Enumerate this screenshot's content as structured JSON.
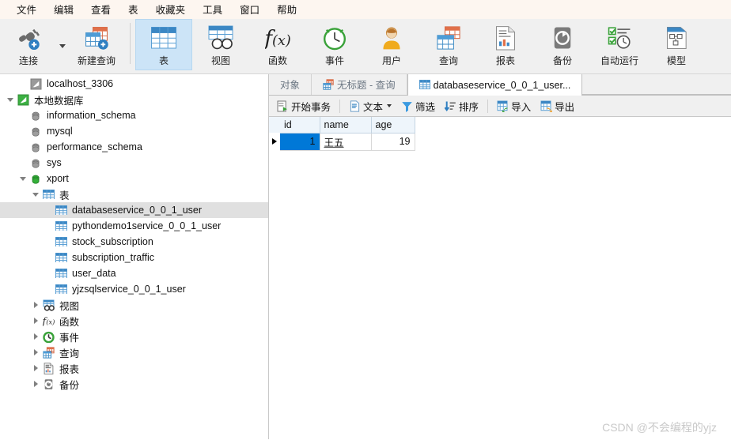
{
  "menubar": {
    "items": [
      {
        "label": "文件",
        "name": "menu-file"
      },
      {
        "label": "编辑",
        "name": "menu-edit"
      },
      {
        "label": "查看",
        "name": "menu-view"
      },
      {
        "label": "表",
        "name": "menu-table"
      },
      {
        "label": "收藏夹",
        "name": "menu-favorites"
      },
      {
        "label": "工具",
        "name": "menu-tools"
      },
      {
        "label": "窗口",
        "name": "menu-window"
      },
      {
        "label": "帮助",
        "name": "menu-help"
      }
    ]
  },
  "toolbar": {
    "buttons": [
      {
        "label": "连接",
        "icon": "connection-plug-icon",
        "selected": false
      },
      {
        "label": "新建查询",
        "icon": "new-query-icon",
        "selected": false
      },
      {
        "label": "表",
        "icon": "table-icon",
        "selected": true
      },
      {
        "label": "视图",
        "icon": "view-icon",
        "selected": false
      },
      {
        "label": "函数",
        "icon": "function-icon",
        "selected": false
      },
      {
        "label": "事件",
        "icon": "event-clock-icon",
        "selected": false
      },
      {
        "label": "用户",
        "icon": "user-icon",
        "selected": false
      },
      {
        "label": "查询",
        "icon": "query-icon",
        "selected": false
      },
      {
        "label": "报表",
        "icon": "report-icon",
        "selected": false
      },
      {
        "label": "备份",
        "icon": "backup-icon",
        "selected": false
      },
      {
        "label": "自动运行",
        "icon": "automation-icon",
        "selected": false
      },
      {
        "label": "模型",
        "icon": "model-icon",
        "selected": false
      }
    ]
  },
  "sidebar": {
    "tree": [
      {
        "label": "localhost_3306",
        "icon": "connection-gray-icon",
        "depth": 1,
        "twisty": "none",
        "selected": false
      },
      {
        "label": "本地数据库",
        "icon": "connection-green-icon",
        "depth": 0,
        "twisty": "expanded",
        "selected": false
      },
      {
        "label": "information_schema",
        "icon": "database-gray-icon",
        "depth": 1,
        "twisty": "none",
        "selected": false
      },
      {
        "label": "mysql",
        "icon": "database-gray-icon",
        "depth": 1,
        "twisty": "none",
        "selected": false
      },
      {
        "label": "performance_schema",
        "icon": "database-gray-icon",
        "depth": 1,
        "twisty": "none",
        "selected": false
      },
      {
        "label": "sys",
        "icon": "database-gray-icon",
        "depth": 1,
        "twisty": "none",
        "selected": false
      },
      {
        "label": "xport",
        "icon": "database-green-icon",
        "depth": 1,
        "twisty": "expanded",
        "selected": false
      },
      {
        "label": "表",
        "icon": "table-icon",
        "depth": 2,
        "twisty": "expanded",
        "selected": false
      },
      {
        "label": "databaseservice_0_0_1_user",
        "icon": "table-icon",
        "depth": 3,
        "twisty": "none",
        "selected": true
      },
      {
        "label": "pythondemo1service_0_0_1_user",
        "icon": "table-icon",
        "depth": 3,
        "twisty": "none",
        "selected": false
      },
      {
        "label": "stock_subscription",
        "icon": "table-icon",
        "depth": 3,
        "twisty": "none",
        "selected": false
      },
      {
        "label": "subscription_traffic",
        "icon": "table-icon",
        "depth": 3,
        "twisty": "none",
        "selected": false
      },
      {
        "label": "user_data",
        "icon": "table-icon",
        "depth": 3,
        "twisty": "none",
        "selected": false
      },
      {
        "label": "yjzsqlservice_0_0_1_user",
        "icon": "table-icon",
        "depth": 3,
        "twisty": "none",
        "selected": false
      },
      {
        "label": "视图",
        "icon": "view-icon",
        "depth": 2,
        "twisty": "collapsed",
        "selected": false
      },
      {
        "label": "函数",
        "icon": "function-icon",
        "depth": 2,
        "twisty": "collapsed",
        "selected": false
      },
      {
        "label": "事件",
        "icon": "event-clock-icon",
        "depth": 2,
        "twisty": "collapsed",
        "selected": false
      },
      {
        "label": "查询",
        "icon": "query-icon",
        "depth": 2,
        "twisty": "collapsed",
        "selected": false
      },
      {
        "label": "报表",
        "icon": "report-icon",
        "depth": 2,
        "twisty": "collapsed",
        "selected": false
      },
      {
        "label": "备份",
        "icon": "backup-icon",
        "depth": 2,
        "twisty": "collapsed",
        "selected": false
      }
    ]
  },
  "tabs": [
    {
      "label": "对象",
      "icon": "none",
      "active": false
    },
    {
      "label": "无标题 - 查询",
      "icon": "query-icon",
      "active": false
    },
    {
      "label": "databaseservice_0_0_1_user...",
      "icon": "table-icon",
      "active": true
    }
  ],
  "gridbar": {
    "buttons": [
      {
        "label": "开始事务",
        "icon": "transaction-icon",
        "caret": false
      },
      {
        "label": "文本",
        "icon": "text-icon",
        "caret": true
      },
      {
        "label": "筛选",
        "icon": "filter-icon",
        "caret": false
      },
      {
        "label": "排序",
        "icon": "sort-icon",
        "caret": false
      },
      {
        "label": "导入",
        "icon": "import-icon",
        "caret": false
      },
      {
        "label": "导出",
        "icon": "export-icon",
        "caret": false
      }
    ]
  },
  "grid": {
    "columns": [
      "id",
      "name",
      "age"
    ],
    "rows": [
      {
        "current": true,
        "id": "1",
        "name": "王五",
        "age": "19"
      }
    ]
  },
  "watermark": "CSDN @不会编程的yjz",
  "colors": {
    "accent": "#0078d7",
    "toolbar_bg": "#f0f0f0",
    "menubar_bg": "#fdf6f0",
    "selected_toolbar_btn": "#cce4f7",
    "selected_tree_row": "#e0e0e0",
    "grid_header_bg": "#eef5fb"
  }
}
